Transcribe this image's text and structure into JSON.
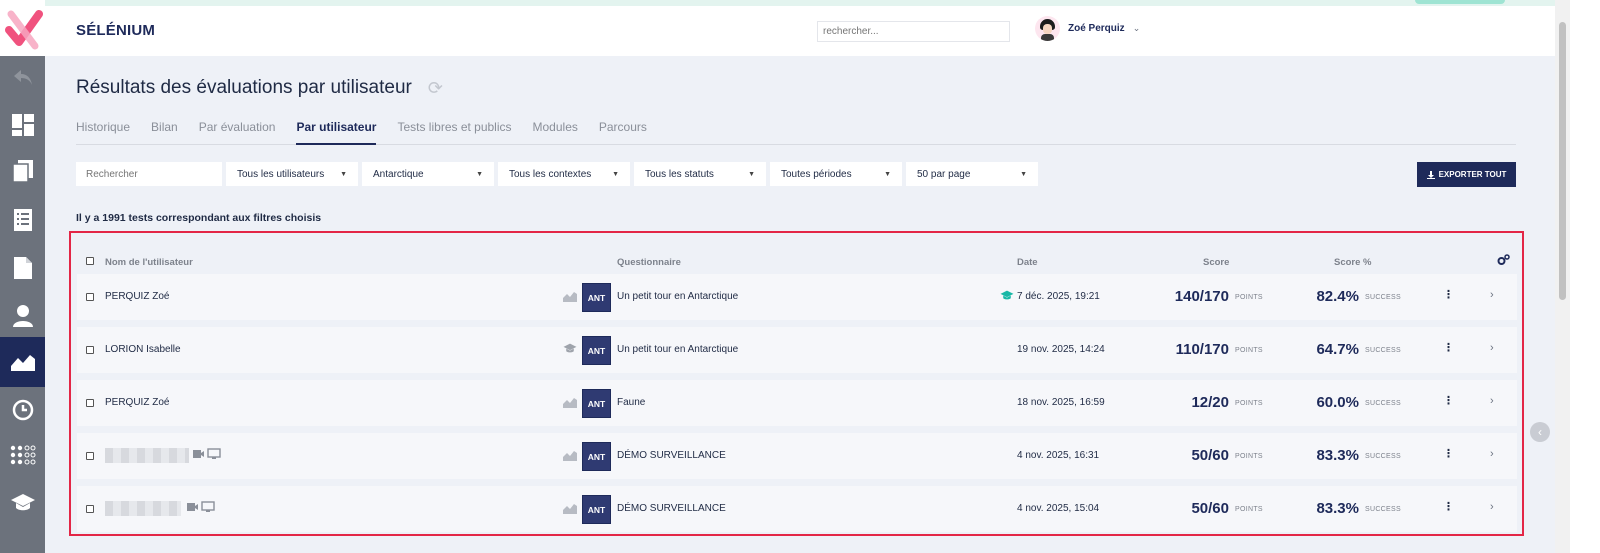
{
  "app": {
    "brand": "SÉLÉNIUM"
  },
  "header": {
    "search_placeholder": "rechercher...",
    "user_name": "Zoé Perquiz",
    "user_chevron": "⌄"
  },
  "sidebar": {
    "items": [
      {
        "icon": "back-arrow-icon"
      },
      {
        "icon": "dashboard-icon"
      },
      {
        "icon": "copy-icon"
      },
      {
        "icon": "list-icon"
      },
      {
        "icon": "document-icon"
      },
      {
        "icon": "user-icon"
      },
      {
        "icon": "chart-icon",
        "active": true
      },
      {
        "icon": "clock-icon"
      },
      {
        "icon": "grid-dots-icon"
      },
      {
        "icon": "graduation-cap-icon"
      }
    ]
  },
  "page": {
    "title": "Résultats des évaluations par utilisateur",
    "tabs": [
      {
        "label": "Historique",
        "active": false
      },
      {
        "label": "Bilan",
        "active": false
      },
      {
        "label": "Par évaluation",
        "active": false
      },
      {
        "label": "Par utilisateur",
        "active": true
      },
      {
        "label": "Tests libres et publics",
        "active": false
      },
      {
        "label": "Modules",
        "active": false
      },
      {
        "label": "Parcours",
        "active": false
      }
    ],
    "filters": {
      "search_placeholder": "Rechercher",
      "selects": [
        {
          "value": "Tous les utilisateurs"
        },
        {
          "value": "Antarctique"
        },
        {
          "value": "Tous les contextes"
        },
        {
          "value": "Tous les statuts"
        },
        {
          "value": "Toutes périodes"
        },
        {
          "value": "50 par page"
        }
      ]
    },
    "export_label": "EXPORTER TOUT",
    "count_text": "Il y a 1991 tests correspondant aux filtres choisis"
  },
  "table": {
    "headers": {
      "user": "Nom de l'utilisateur",
      "quiz": "Questionnaire",
      "date": "Date",
      "score": "Score",
      "pct": "Score %"
    },
    "rows": [
      {
        "user": "PERQUIZ Zoé",
        "blurred": false,
        "tag": "ANT",
        "quiz": "Un petit tour en Antarctique",
        "cap": true,
        "cap_color": "#18b8a6",
        "date": "7 déc. 2025, 19:21",
        "score": "140/170",
        "unit": "POINTS",
        "pct": "82.4%",
        "status": "SUCCESS"
      },
      {
        "user": "LORION Isabelle",
        "blurred": false,
        "stat_icon": "graduation-cap-icon",
        "tag": "ANT",
        "quiz": "Un petit tour en Antarctique",
        "cap": false,
        "date": "19 nov. 2025, 14:24",
        "score": "110/170",
        "unit": "POINTS",
        "pct": "64.7%",
        "status": "SUCCESS"
      },
      {
        "user": "PERQUIZ Zoé",
        "blurred": false,
        "tag": "ANT",
        "quiz": "Faune",
        "cap": false,
        "date": "18 nov. 2025, 16:59",
        "score": "12/20",
        "unit": "POINTS",
        "pct": "60.0%",
        "status": "SUCCESS"
      },
      {
        "user": "",
        "blurred": true,
        "tag": "ANT",
        "quiz": "DÉMO SURVEILLANCE",
        "cap": false,
        "date": "4 nov. 2025, 16:31",
        "score": "50/60",
        "unit": "POINTS",
        "pct": "83.3%",
        "status": "SUCCESS"
      },
      {
        "user": "",
        "blurred": true,
        "tag": "ANT",
        "quiz": "DÉMO SURVEILLANCE",
        "cap": false,
        "date": "4 nov. 2025, 15:04",
        "score": "50/60",
        "unit": "POINTS",
        "pct": "83.3%",
        "status": "SUCCESS"
      }
    ]
  },
  "colors": {
    "accent": "#1e2a5a",
    "highlight_border": "#e32646",
    "logo_pink": "#f0527e"
  }
}
